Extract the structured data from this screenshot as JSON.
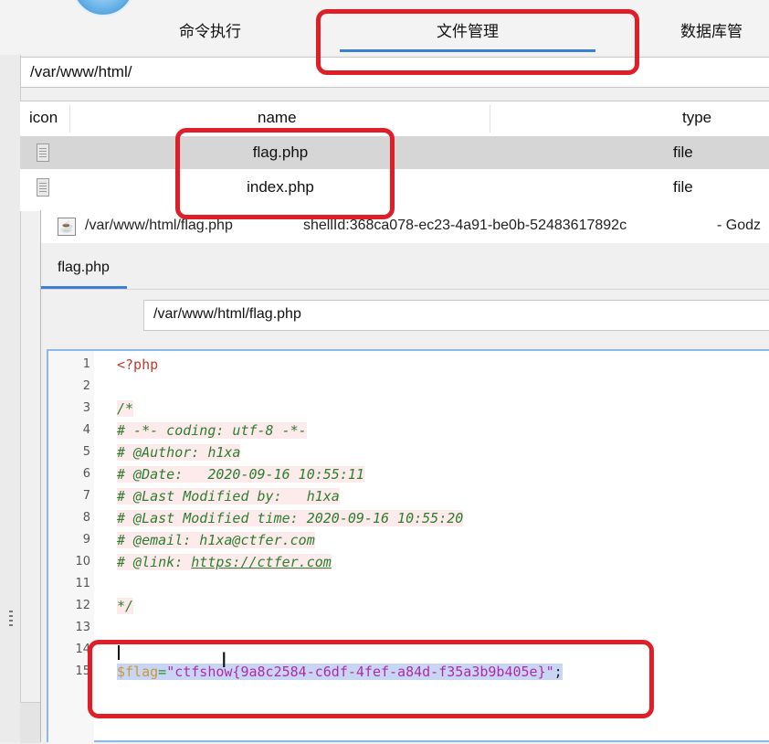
{
  "tabs": {
    "command_exec": "命令执行",
    "file_manager": "文件管理",
    "db_manager": "数据库管"
  },
  "path_bar": {
    "value": "/var/www/html/"
  },
  "file_table": {
    "columns": [
      "icon",
      "name",
      "type"
    ],
    "rows": [
      {
        "name": "flag.php",
        "type": "file",
        "selected": true
      },
      {
        "name": "index.php",
        "type": "file",
        "selected": false
      }
    ]
  },
  "editor_window": {
    "title_path": "/var/www/html/flag.php",
    "title_shell": "shellId:368ca078-ec23-4a91-be0b-52483617892c",
    "title_app": "- Godz",
    "doc_tab": "flag.php",
    "file_path": "/var/www/html/flag.php"
  },
  "code": {
    "line_numbers": [
      "1",
      "2",
      "3",
      "4",
      "5",
      "6",
      "7",
      "8",
      "9",
      "10",
      "11",
      "12",
      "13",
      "14",
      "15"
    ],
    "l1": "<?php",
    "l3": "/*",
    "l4": "# -*- coding: utf-8 -*-",
    "l5": "# @Author: h1xa",
    "l6": "# @Date:   2020-09-16 10:55:11",
    "l7": "# @Last Modified by:   h1xa",
    "l8": "# @Last Modified time: 2020-09-16 10:55:20",
    "l9": "# @email: h1xa@ctfer.com",
    "l10_prefix": "# @link: ",
    "l10_link": "https://ctfer.com",
    "l12": "*/",
    "l15_var": "$flag",
    "l15_op": "=",
    "l15_str": "\"ctfshow{9a8c2584-c6df-4fef-a84d-f35a3b9b405e}\"",
    "l15_end": ";"
  },
  "colors": {
    "highlight_red": "#e01e27",
    "accent_blue": "#3d7fd6",
    "selection": "#c9d6f3"
  }
}
